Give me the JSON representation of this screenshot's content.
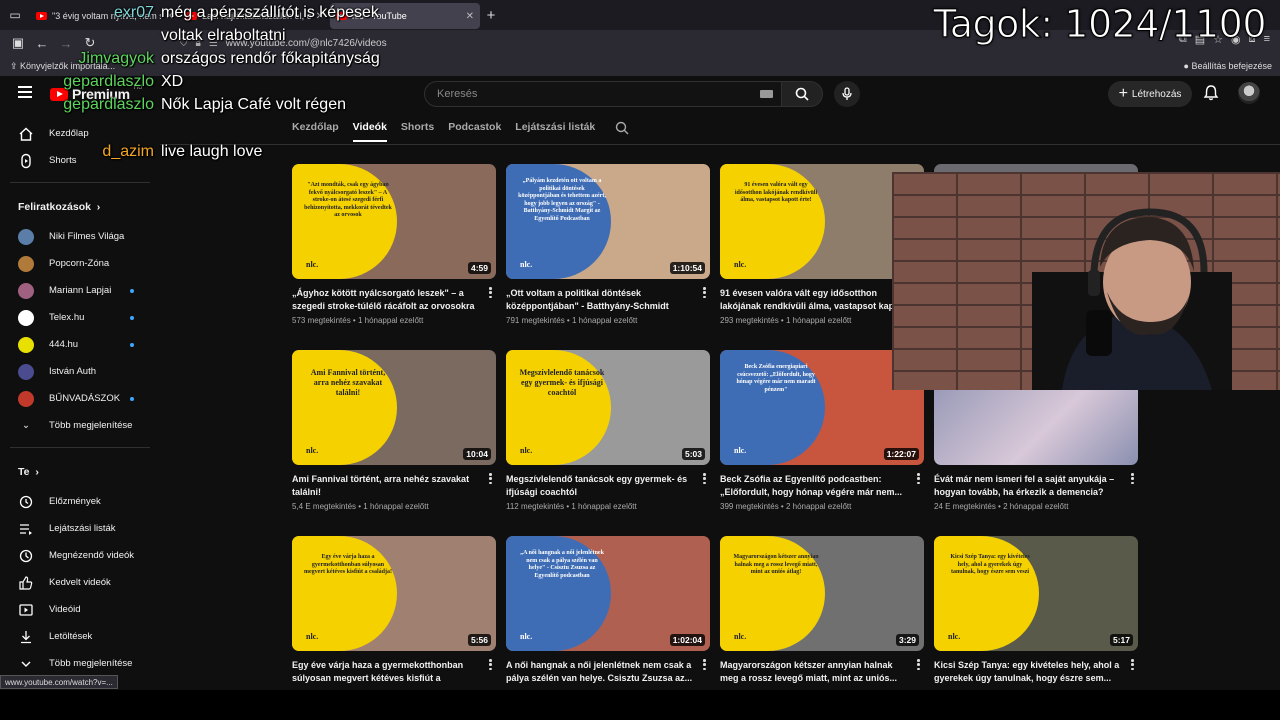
{
  "browser": {
    "tabs": [
      {
        "label": "\"3 évig voltam nyitva, nem szer",
        "active": false
      },
      {
        "label": "Laci hajléktalanszállón él, onnan",
        "active": false
      },
      {
        "label": "nlc - YouTube",
        "active": true
      }
    ],
    "url": "www.youtube.com/@nlc7426/videos",
    "bookmarks_left": "Könyvjelzők importálá...",
    "bookmarks_right": "Beállítás befejezése",
    "status_url": "www.youtube.com/watch?v=..."
  },
  "stream_overlay": {
    "member_count": "Tagok: 1024/1100"
  },
  "header": {
    "brand": "Premium",
    "country_code": "HU",
    "search_placeholder": "Keresés",
    "create_label": "Létrehozás"
  },
  "sidebar": {
    "primary": [
      {
        "label": "Kezdőlap",
        "icon": "home-icon"
      },
      {
        "label": "Shorts",
        "icon": "shorts-icon"
      }
    ],
    "subscriptions_title": "Feliratkozások",
    "subscriptions": [
      {
        "label": "Niki Filmes Világa",
        "color": "#5a7ea8",
        "live": false
      },
      {
        "label": "Popcorn-Zóna",
        "color": "#b07a3a",
        "live": false
      },
      {
        "label": "Mariann Lapjai",
        "color": "#a06080",
        "live": true
      },
      {
        "label": "Telex.hu",
        "color": "#ffffff",
        "live": true
      },
      {
        "label": "444.hu",
        "color": "#e8e000",
        "live": true
      },
      {
        "label": "István Auth",
        "color": "#4b4b8f",
        "live": false
      },
      {
        "label": "BŰNVADÁSZOK",
        "color": "#c0392b",
        "live": true
      }
    ],
    "more_label": "Több megjelenítése",
    "you_title": "Te",
    "you_items": [
      {
        "label": "Előzmények",
        "icon": "history-icon"
      },
      {
        "label": "Lejátszási listák",
        "icon": "playlists-icon"
      },
      {
        "label": "Megnézendő videók",
        "icon": "watch-later-icon"
      },
      {
        "label": "Kedvelt videók",
        "icon": "like-icon"
      },
      {
        "label": "Videóid",
        "icon": "your-videos-icon"
      },
      {
        "label": "Letöltések",
        "icon": "downloads-icon"
      },
      {
        "label": "Több megjelenítése",
        "icon": "chevron-down-icon"
      }
    ]
  },
  "channel_tabs": [
    {
      "label": "Kezdőlap",
      "active": false
    },
    {
      "label": "Videók",
      "active": true
    },
    {
      "label": "Shorts",
      "active": false
    },
    {
      "label": "Podcastok",
      "active": false
    },
    {
      "label": "Lejátszási listák",
      "active": false
    }
  ],
  "videos": [
    {
      "title": "„Ágyhoz kötött nyálcsorgató leszek\" – a szegedi stroke-túlélő rácáfolt az orvosokra",
      "views": "573 megtekintés",
      "age": "1 hónappal ezelőtt",
      "duration": "4:59",
      "thumb_text": "\"Azt mondták, csak egy ágyban fekvő nyálcsorgató leszek\" – A stroke-on átesé szegedi férfi behizonyította, mekkorát tévedtek az orvosok",
      "style": "yellow",
      "photo": "#8a6a5a"
    },
    {
      "title": "„Ott voltam a politikai döntések középpontjában\" - Batthyány-Schmidt Mar...",
      "views": "791 megtekintés",
      "age": "1 hónappal ezelőtt",
      "duration": "1:10:54",
      "thumb_text": "„Pályám kezdetén ott voltam a politikai döntések középpontjában és tehettem azért, hogy jobb legyen az ország\" - Batthyány-Schmidt Margit az Egyenlítő Podcastban",
      "style": "blue",
      "photo": "#c9a98a"
    },
    {
      "title": "91 évesen valóra vált egy idősotthon lakójának rendkívüli álma, vastapsot kapo",
      "views": "293 megtekintés",
      "age": "1 hónappal ezelőtt",
      "duration": "",
      "thumb_text": "91 évesen valóra vált egy idősotthon lakójának rendkívüli álma, vastapsot kapott érte!",
      "style": "yellow",
      "photo": "#8e7d6a"
    },
    {
      "title": "Ami Fannival történt, arra nehéz szavakat találni!",
      "views": "5,4 E megtekintés",
      "age": "1 hónappal ezelőtt",
      "duration": "10:04",
      "thumb_text": "Ami Fannival történt, arra nehéz szavakat találni!",
      "style": "yellow",
      "photo": "#7a6a60"
    },
    {
      "title": "Megszívlelendő tanácsok egy gyermek- és ifjúsági coachtól",
      "views": "112 megtekintés",
      "age": "1 hónappal ezelőtt",
      "duration": "5:03",
      "thumb_text": "Megszívlelendő tanácsok egy gyermek- és ifjúsági coachtól",
      "style": "yellow",
      "photo": "#9a9a9a"
    },
    {
      "title": "Beck Zsófia az Egyenlítő podcastben: „Előfordult, hogy hónap végére már nem...",
      "views": "399 megtekintés",
      "age": "2 hónappal ezelőtt",
      "duration": "1:22:07",
      "thumb_text": "Beck Zsófia energiapiari csúcsvezető: „Előfordult, hogy hónap végére már nem maradt pénzem\"",
      "style": "blue",
      "photo": "#c8553d"
    },
    {
      "title": "Évát már nem ismeri fel a saját anyukája – hogyan tovább, ha érkezik a demencia?",
      "views": "24 E megtekintés",
      "age": "2 hónappal ezelőtt",
      "duration": "",
      "thumb_text": "",
      "style": "photo",
      "photo": "#8a8fb0"
    },
    {
      "title": "Egy éve várja haza a gyermekotthonban súlyosan megvert kétéves kisfiút a családja!",
      "views": "",
      "age": "",
      "duration": "5:56",
      "thumb_text": "Egy éve várja haza a gyermekotthonban súlyosan megvert kétéves kisfiút a családja!",
      "style": "yellow",
      "photo": "#a08070"
    },
    {
      "title": "A női hangnak a női jelenlétnek nem csak a pálya szélén van helye. Csisztu Zsuzsa az...",
      "views": "",
      "age": "",
      "duration": "1:02:04",
      "thumb_text": "„A női hangnak a női jelenlétnek nem csak a pálya szélén van helye\" - Csisztu Zsuzsa az Egyenlítő podcastban",
      "style": "blue",
      "photo": "#b06050"
    },
    {
      "title": "Magyarországon kétszer annyian halnak meg a rossz levegő miatt, mint az uniós...",
      "views": "",
      "age": "",
      "duration": "3:29",
      "thumb_text": "Magyarországon kétszer annyian halnak meg a rossz levegő miatt, mint az uniós átlag!",
      "style": "yellow",
      "photo": "#707070"
    },
    {
      "title": "Kicsi Szép Tanya: egy kivételes hely, ahol a gyerekek úgy tanulnak, hogy észre sem...",
      "views": "",
      "age": "",
      "duration": "5:17",
      "thumb_text": "Kicsi Szép Tanya: egy kivételes hely, ahol a gyerekek úgy tanulnak, hogy észre sem veszi",
      "style": "yellow",
      "photo": "#5a5a4a"
    }
  ],
  "partial_video": {
    "duration": "",
    "style": "photo",
    "photo": "#6a6a70"
  },
  "nlc_brand": "nlc.",
  "chat": [
    {
      "user": "exr07",
      "color": "#7fd6d6",
      "message": "még a pénzszállítót is képesek"
    },
    {
      "user": "",
      "color": "#ffffff",
      "message": "voltak elraboltatni"
    },
    {
      "user": "Jimvagyok",
      "color": "#5dd55d",
      "message": "országos rendőr főkapitányság"
    },
    {
      "user": "gepardlaszlo",
      "color": "#5dd55d",
      "message": "XD"
    },
    {
      "user": "gepardlaszlo",
      "color": "#5dd55d",
      "message": "Nők Lapja Café volt régen"
    },
    {
      "user": "d_azim",
      "color": "#f5a623",
      "message": "live laugh love"
    }
  ]
}
